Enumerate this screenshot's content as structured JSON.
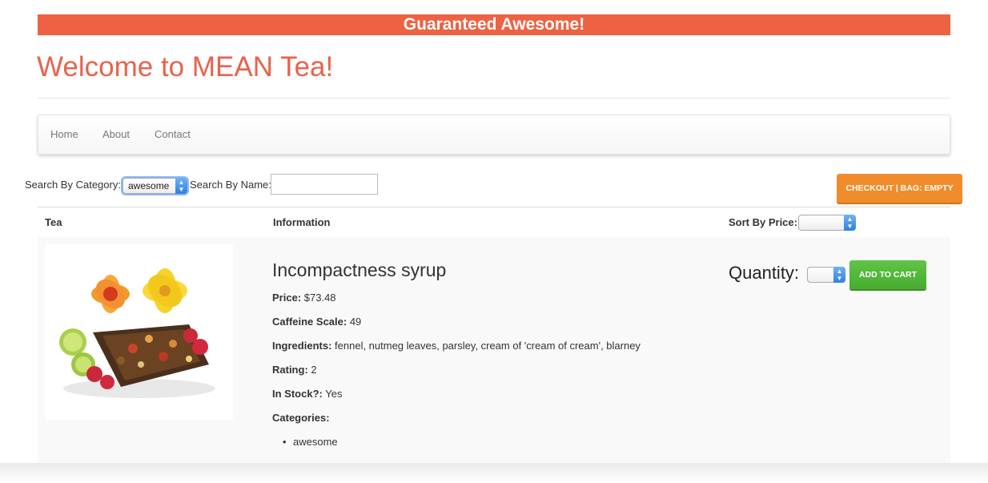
{
  "banner": {
    "text": "Guaranteed Awesome!"
  },
  "header": {
    "title": "Welcome to MEAN Tea!"
  },
  "nav": {
    "home": "Home",
    "about": "About",
    "contact": "Contact"
  },
  "search": {
    "category_label": "Search By Category:",
    "category_value": "awesome",
    "name_label": "Search By Name:",
    "name_value": ""
  },
  "checkout": {
    "label": "CHECKOUT | BAG: EMPTY"
  },
  "table": {
    "headers": {
      "tea": "Tea",
      "information": "Information",
      "sort_by_price": "Sort By Price:"
    },
    "sort_value": ""
  },
  "product": {
    "name": "Incompactness syrup",
    "price_label": "Price:",
    "price": "$73.48",
    "caffeine_label": "Caffeine Scale:",
    "caffeine": "49",
    "ingredients_label": "Ingredients:",
    "ingredients": "fennel, nutmeg leaves, parsley, cream of 'cream of cream', blarney",
    "rating_label": "Rating:",
    "rating": "2",
    "stock_label": "In Stock?:",
    "stock": "Yes",
    "categories_label": "Categories:",
    "categories": [
      "awesome"
    ],
    "quantity_label": "Quantity:",
    "quantity_value": "",
    "add_to_cart": "ADD TO CART"
  },
  "colors": {
    "brand": "#ed6243",
    "checkout": "#f08c2b",
    "add_to_cart": "#52b83a"
  }
}
